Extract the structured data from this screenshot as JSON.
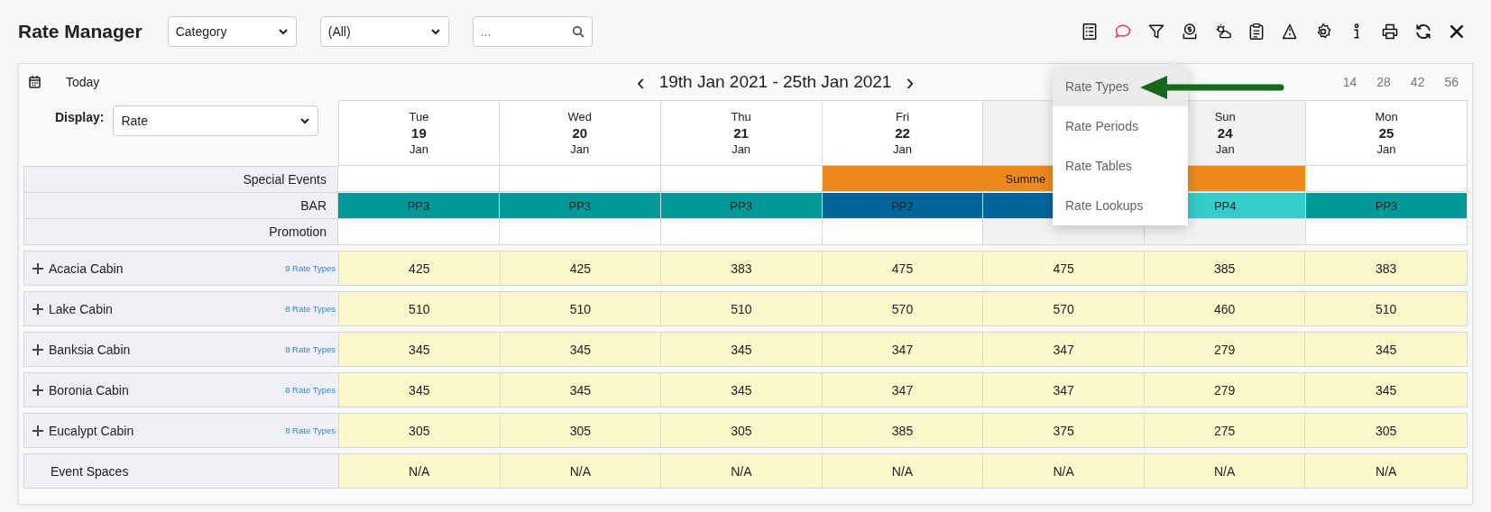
{
  "title": "Rate Manager",
  "filters": {
    "category": "Category",
    "scope": "(All)",
    "search_placeholder": "..."
  },
  "toolbar": [
    {
      "kind": "checklist"
    },
    {
      "kind": "chat"
    },
    {
      "kind": "filter"
    },
    {
      "kind": "money"
    },
    {
      "kind": "weather"
    },
    {
      "kind": "clipboard"
    },
    {
      "kind": "road"
    },
    {
      "kind": "settings"
    },
    {
      "kind": "info"
    },
    {
      "kind": "print"
    },
    {
      "kind": "refresh"
    },
    {
      "kind": "close"
    }
  ],
  "today": "Today",
  "range": {
    "prev": "‹",
    "label": "19th Jan 2021 - 25th Jan 2021",
    "next": "›"
  },
  "page_sizes": [
    "14",
    "28",
    "42",
    "56"
  ],
  "display": {
    "label": "Display:",
    "value": "Rate"
  },
  "days": [
    {
      "dow": "Tue",
      "day": "19",
      "month": "Jan",
      "weekend": false
    },
    {
      "dow": "Wed",
      "day": "20",
      "month": "Jan",
      "weekend": false
    },
    {
      "dow": "Thu",
      "day": "21",
      "month": "Jan",
      "weekend": false
    },
    {
      "dow": "Fri",
      "day": "22",
      "month": "Jan",
      "weekend": false
    },
    {
      "weekend": true
    },
    {
      "dow": "Sun",
      "day": "24",
      "month": "Jan",
      "weekend": true
    },
    {
      "dow": "Mon",
      "day": "25",
      "month": "Jan",
      "weekend": false
    }
  ],
  "info_rows": {
    "special_events_label": "Special Events",
    "bar_label": "BAR",
    "promotion_label": "Promotion"
  },
  "special_events": [
    {
      "event": false
    },
    {
      "event": false
    },
    {
      "event": false
    },
    {
      "event": true,
      "label": "Summe"
    },
    {
      "event": true
    },
    {
      "event": true
    },
    {
      "event": false
    }
  ],
  "bar": [
    {
      "label": "PP3",
      "color": "#009999"
    },
    {
      "label": "PP3",
      "color": "#009999"
    },
    {
      "label": "PP3",
      "color": "#009999"
    },
    {
      "label": "PP2",
      "color": "#006699"
    },
    {
      "color": "#006699"
    },
    {
      "label": "PP4",
      "color": "#33cccc"
    },
    {
      "label": "PP3",
      "color": "#009999"
    }
  ],
  "rooms": [
    {
      "name": "Acacia Cabin",
      "expandable": true,
      "rate_types": "9 Rate Types",
      "rates": [
        "425",
        "425",
        "383",
        "475",
        "475",
        "385",
        "383"
      ]
    },
    {
      "name": "Lake Cabin",
      "expandable": true,
      "rate_types": "8 Rate Types",
      "rates": [
        "510",
        "510",
        "510",
        "570",
        "570",
        "460",
        "510"
      ]
    },
    {
      "name": "Banksia Cabin",
      "expandable": true,
      "rate_types": "8 Rate Types",
      "rates": [
        "345",
        "345",
        "345",
        "347",
        "347",
        "279",
        "345"
      ]
    },
    {
      "name": "Boronia Cabin",
      "expandable": true,
      "rate_types": "8 Rate Types",
      "rates": [
        "345",
        "345",
        "345",
        "347",
        "347",
        "279",
        "345"
      ]
    },
    {
      "name": "Eucalypt Cabin",
      "expandable": true,
      "rate_types": "8 Rate Types",
      "rates": [
        "305",
        "305",
        "305",
        "385",
        "375",
        "275",
        "305"
      ]
    },
    {
      "name": "Event Spaces",
      "expandable": false,
      "rates": [
        "N/A",
        "N/A",
        "N/A",
        "N/A",
        "N/A",
        "N/A",
        "N/A"
      ]
    }
  ],
  "menu": [
    {
      "label": "Rate Types",
      "selected": true
    },
    {
      "label": "Rate Periods",
      "selected": false
    },
    {
      "label": "Rate Tables",
      "selected": false
    },
    {
      "label": "Rate Lookups",
      "selected": false
    }
  ]
}
